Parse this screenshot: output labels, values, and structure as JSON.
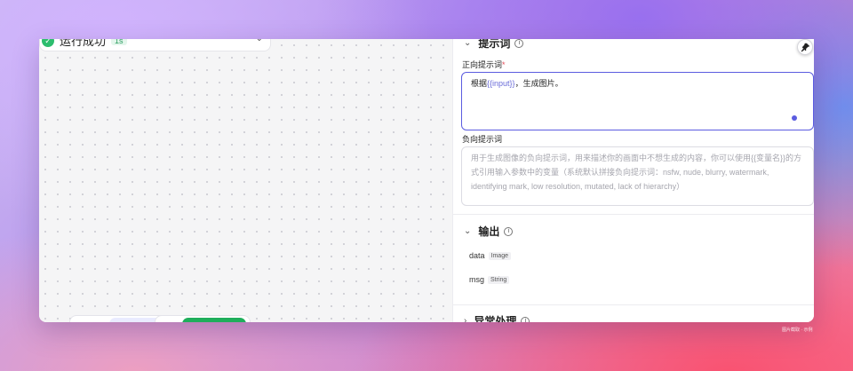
{
  "canvas": {
    "run_status": "运行成功",
    "run_time": "1s"
  },
  "panel": {
    "prompt_section": {
      "title": "提示词"
    },
    "positive": {
      "label": "正向提示词",
      "required_mark": "*",
      "value_prefix": "根据",
      "value_var": "{{input}}",
      "value_suffix": "，生成图片。"
    },
    "negative": {
      "label": "负向提示词",
      "placeholder": "用于生成图像的负向提示词，用来描述你的画面中不想生成的内容，你可以使用{{变量名}}的方式引用输入参数中的变量（系统默认拼接负向提示词：nsfw, nude, blurry, watermark, identifying mark, low resolution, mutated, lack of hierarchy）"
    },
    "output_section": {
      "title": "输出",
      "items": [
        {
          "name": "data",
          "type": "Image"
        },
        {
          "name": "msg",
          "type": "String"
        }
      ]
    },
    "exception_section": {
      "title": "异常处理"
    }
  },
  "credit": "图片截取 · 示例"
}
